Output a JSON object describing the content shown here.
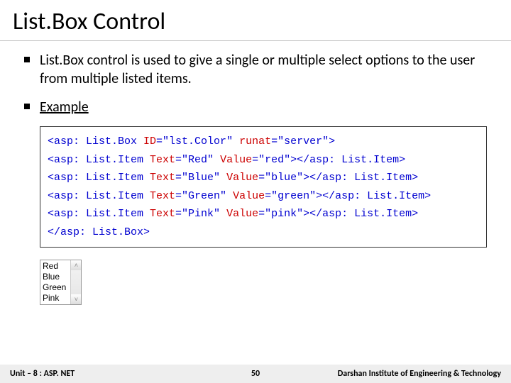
{
  "title": "List.Box Control",
  "bullets": {
    "b1": "List.Box control is used to give a single or multiple select options to the user from multiple listed items.",
    "b2": "Example"
  },
  "code": {
    "l1_a": "<asp: List.Box ",
    "l1_b": "ID",
    "l1_c": "=\"lst.Color\" ",
    "l1_d": "runat",
    "l1_e": "=\"server\">",
    "l2_a": "<asp: List.Item ",
    "l2_b": "Text",
    "l2_c": "=\"Red\" ",
    "l2_d": "Value",
    "l2_e": "=\"red\"></asp: List.Item>",
    "l3_a": "<asp: List.Item ",
    "l3_b": "Text",
    "l3_c": "=\"Blue\" ",
    "l3_d": "Value",
    "l3_e": "=\"blue\"></asp: List.Item>",
    "l4_a": "<asp: List.Item ",
    "l4_b": "Text",
    "l4_c": "=\"Green\" ",
    "l4_d": "Value",
    "l4_e": "=\"green\"></asp: List.Item>",
    "l5_a": "<asp: List.Item ",
    "l5_b": "Text",
    "l5_c": "=\"Pink\" ",
    "l5_d": "Value",
    "l5_e": "=\"pink\"></asp: List.Item>",
    "l6": "</asp: List.Box>"
  },
  "listbox": {
    "items": {
      "i0": "Red",
      "i1": "Blue",
      "i2": "Green",
      "i3": "Pink"
    },
    "up": "˄",
    "down": "˅"
  },
  "footer": {
    "left": "Unit – 8 : ASP. NET",
    "page": "50",
    "right": "Darshan Institute of Engineering & Technology"
  }
}
